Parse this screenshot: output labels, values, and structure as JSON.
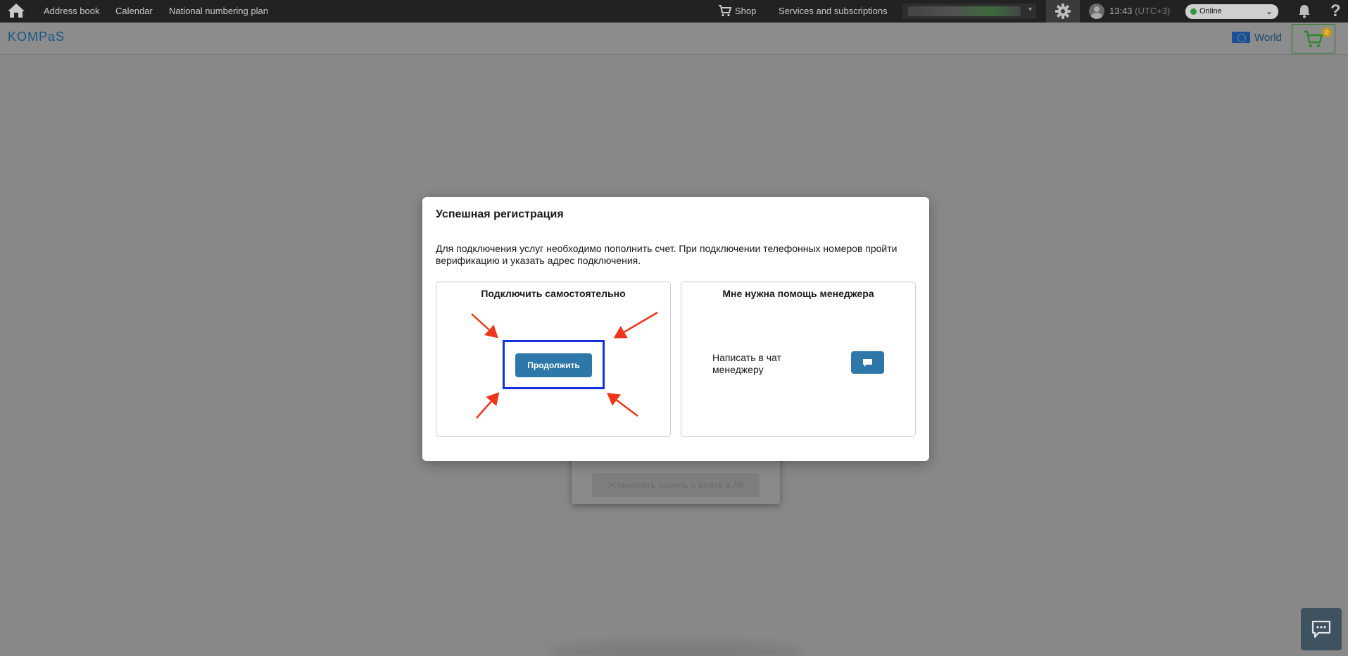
{
  "topbar": {
    "nav": [
      "Address book",
      "Calendar",
      "National numbering plan"
    ],
    "shop_label": "Shop",
    "services_label": "Services and subscriptions",
    "time": "13:43",
    "timezone": "(UTC+3)",
    "status": "Online"
  },
  "header": {
    "logo": "KOMPaS",
    "region": "World",
    "cart_count": "0"
  },
  "background_form": {
    "submit_label": "Установить пароль и войти в ЛК"
  },
  "modal": {
    "title": "Успешная регистрация",
    "description": "Для подключения услуг необходимо пополнить счет. При подключении телефонных номеров пройти верификацию и указать адрес подключения.",
    "self_panel": {
      "title": "Подключить самостоятельно",
      "button_label": "Продолжить"
    },
    "manager_panel": {
      "title": "Мне нужна помощь менеджера",
      "chat_label": "Написать в чат менеджеру"
    }
  },
  "colors": {
    "accent": "#2d78a8",
    "highlight": "#1530e0",
    "annotation_arrow": "#f0361a",
    "status_online": "#2f9a3c"
  }
}
